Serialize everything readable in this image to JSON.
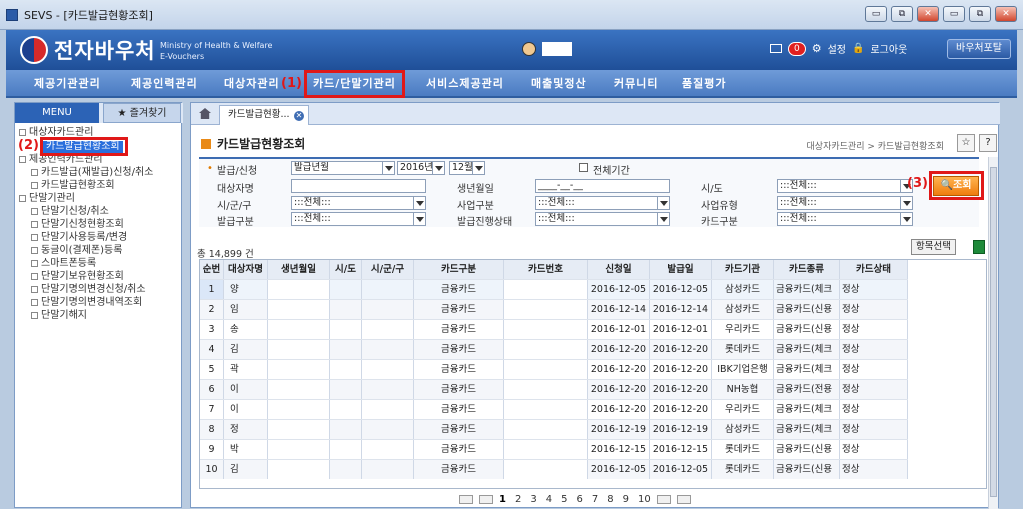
{
  "window": {
    "title": "SEVS - [카드발급현황조회]",
    "buttons": [
      "▭",
      "⧉",
      "✕",
      "▭",
      "⧉",
      "✕"
    ]
  },
  "header": {
    "logo_text": "전자바우처",
    "logo_sub_1": "Ministry of Health & Welfare",
    "logo_sub_2": "E-Vouchers",
    "mail_count": "0",
    "settings_label": "설정",
    "logout_label": "로그아웃",
    "portal_label": "바우처포탈"
  },
  "main_menu": {
    "items": [
      "제공기관관리",
      "제공인력관리",
      "대상자관리",
      "카드/단말기관리",
      "서비스제공관리",
      "매출및정산",
      "커뮤니티",
      "품질평가"
    ]
  },
  "annotations": {
    "a1": "(1)",
    "a2": "(2)",
    "a3": "(3)"
  },
  "left_panel": {
    "tab_menu": "MENU",
    "tab_favorites": "즐겨찾기",
    "tree": [
      "대상자카드관리",
      "카드발급현황조회",
      "제공인력카드관리",
      "카드발급(재발급)신청/취소",
      "카드발급현황조회",
      "단말기관리",
      "단말기신청/취소",
      "단말기신청현황조회",
      "단말기사용등록/변경",
      "동글이(결제폰)등록",
      "스마트폰등록",
      "단말기보유현황조회",
      "단말기명의변경신청/취소",
      "단말기명의변경내역조회",
      "단말기해지"
    ]
  },
  "content": {
    "tab_label": "카드발급현황...",
    "page_title": "카드발급현황조회",
    "breadcrumb": "대상자카드관리 > 카드발급현황조회",
    "search": {
      "issue_label": "발급/신청",
      "issue_type": "발급년월",
      "year": "2016년",
      "month": "12월",
      "all_period": "전체기간",
      "target_label": "대상자명",
      "birth_label": "생년월일",
      "birth_placeholder": "____-__-__",
      "sido_label": "시/도",
      "sido_value": ":::전체:::",
      "sigungu_label": "시/군/구",
      "sigungu_value": ":::전체:::",
      "biz_type_label": "사업구분",
      "biz_type_value": ":::전체:::",
      "biz_kind_label": "사업유형",
      "biz_kind_value": ":::전체:::",
      "issue_kind_label": "발급구분",
      "issue_kind_value": ":::전체:::",
      "progress_label": "발급진행상태",
      "progress_value": ":::전체:::",
      "card_kind_label": "카드구분",
      "card_kind_value": ":::전체:::",
      "search_button": "조회"
    },
    "count_text": "총 14,899 건",
    "select_items_button": "항목선택",
    "columns": [
      "순번",
      "대상자명",
      "생년월일",
      "시/도",
      "시/군/구",
      "카드구분",
      "카드번호",
      "신청일",
      "발급일",
      "카드기관",
      "카드종류",
      "카드상태"
    ],
    "rows": [
      [
        "1",
        "양",
        "",
        "",
        "",
        "금융카드",
        "",
        "2016-12-05",
        "2016-12-05",
        "삼성카드",
        "금융카드(체크",
        "정상"
      ],
      [
        "2",
        "임",
        "",
        "",
        "",
        "금융카드",
        "",
        "2016-12-14",
        "2016-12-14",
        "삼성카드",
        "금융카드(신용",
        "정상"
      ],
      [
        "3",
        "송",
        "",
        "",
        "",
        "금융카드",
        "",
        "2016-12-01",
        "2016-12-01",
        "우리카드",
        "금융카드(신용",
        "정상"
      ],
      [
        "4",
        "김",
        "",
        "",
        "",
        "금융카드",
        "",
        "2016-12-20",
        "2016-12-20",
        "롯데카드",
        "금융카드(체크",
        "정상"
      ],
      [
        "5",
        "곽",
        "",
        "",
        "",
        "금융카드",
        "",
        "2016-12-20",
        "2016-12-20",
        "IBK기업은행",
        "금융카드(체크",
        "정상"
      ],
      [
        "6",
        "이",
        "",
        "",
        "",
        "금융카드",
        "",
        "2016-12-20",
        "2016-12-20",
        "NH농협",
        "금융카드(전용",
        "정상"
      ],
      [
        "7",
        "이",
        "",
        "",
        "",
        "금융카드",
        "",
        "2016-12-20",
        "2016-12-20",
        "우리카드",
        "금융카드(체크",
        "정상"
      ],
      [
        "8",
        "정",
        "",
        "",
        "",
        "금융카드",
        "",
        "2016-12-19",
        "2016-12-19",
        "삼성카드",
        "금융카드(체크",
        "정상"
      ],
      [
        "9",
        "박",
        "",
        "",
        "",
        "금융카드",
        "",
        "2016-12-15",
        "2016-12-15",
        "롯데카드",
        "금융카드(신용",
        "정상"
      ],
      [
        "10",
        "김",
        "",
        "",
        "",
        "금융카드",
        "",
        "2016-12-05",
        "2016-12-05",
        "롯데카드",
        "금융카드(신용",
        "정상"
      ]
    ],
    "pages": [
      "1",
      "2",
      "3",
      "4",
      "5",
      "6",
      "7",
      "8",
      "9",
      "10"
    ],
    "current_page": "1"
  }
}
